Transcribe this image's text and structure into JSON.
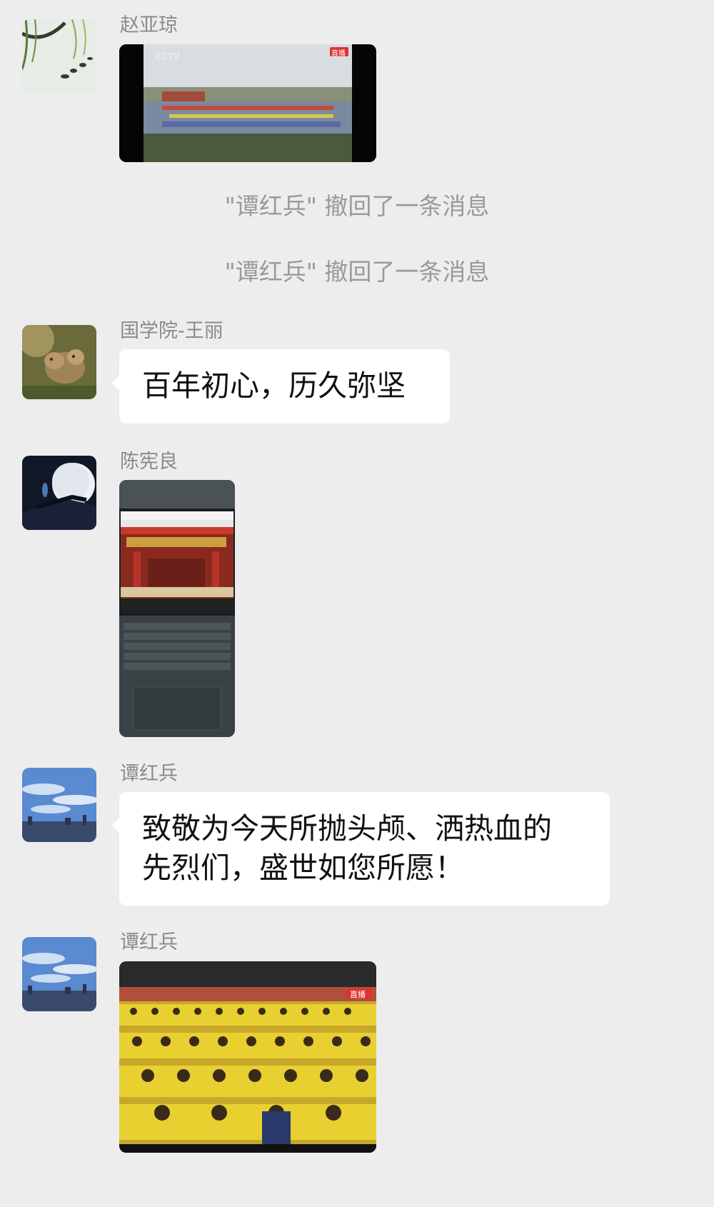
{
  "messages": [
    {
      "sender": "赵亚琼",
      "type": "video"
    },
    {
      "sender": "国学院-王丽",
      "type": "text",
      "text": "百年初心，历久弥坚"
    },
    {
      "sender": "陈宪良",
      "type": "image"
    },
    {
      "sender": "谭红兵",
      "type": "text",
      "text_lines": [
        "致敬为今天所抛头颅、洒热血的",
        "先烈们，盛世如您所愿！"
      ]
    },
    {
      "sender": "谭红兵",
      "type": "image"
    }
  ],
  "system_notices": [
    "\"谭红兵\" 撤回了一条消息",
    "\"谭红兵\" 撤回了一条消息"
  ],
  "media_overlays": {
    "cctv_logo": "CCTV",
    "live_badge": "直播"
  },
  "colors": {
    "chat_background": "#ededed",
    "bubble": "#ffffff",
    "sender_text": "#8a8a8a",
    "notice_text": "#9a9a9a"
  }
}
